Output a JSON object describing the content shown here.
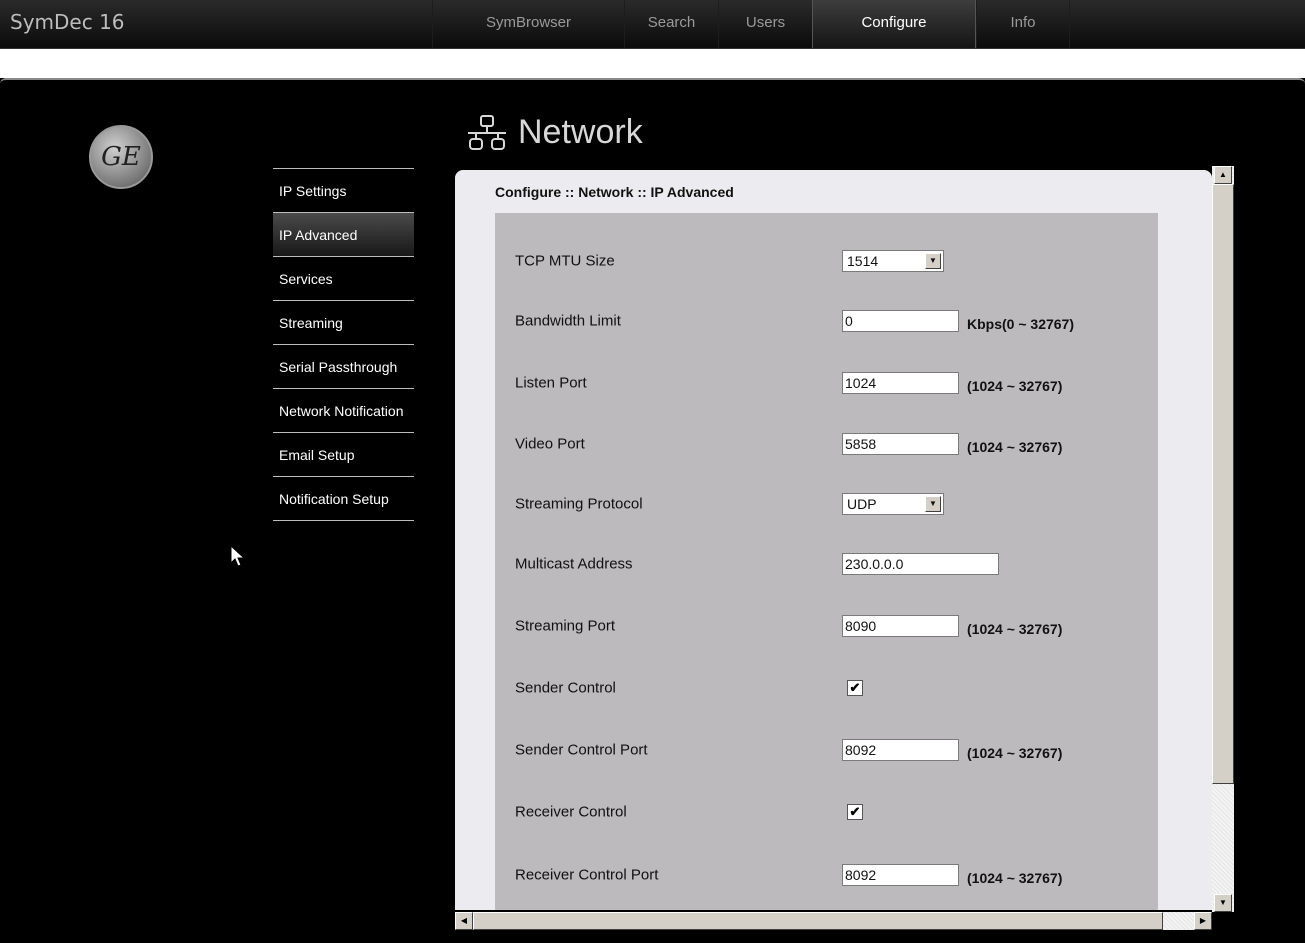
{
  "app": {
    "title": "SymDec 16"
  },
  "tabs": [
    {
      "label": "SymBrowser",
      "active": false
    },
    {
      "label": "Search",
      "active": false
    },
    {
      "label": "Users",
      "active": false
    },
    {
      "label": "Configure",
      "active": true
    },
    {
      "label": "Info",
      "active": false
    }
  ],
  "logo": {
    "text": "GE",
    "icon": "ge-logo"
  },
  "page": {
    "title": "Network",
    "icon": "network-icon"
  },
  "sidebar": {
    "items": [
      {
        "label": "IP Settings",
        "active": false
      },
      {
        "label": "IP Advanced",
        "active": true
      },
      {
        "label": "Services",
        "active": false
      },
      {
        "label": "Streaming",
        "active": false
      },
      {
        "label": "Serial Passthrough",
        "active": false
      },
      {
        "label": "Network Notification",
        "active": false
      },
      {
        "label": "Email Setup",
        "active": false
      },
      {
        "label": "Notification Setup",
        "active": false
      }
    ]
  },
  "content": {
    "breadcrumb": "Configure :: Network :: IP Advanced",
    "rows": {
      "tcp_mtu": {
        "label": "TCP MTU Size",
        "value": "1514"
      },
      "bandwidth": {
        "label": "Bandwidth Limit",
        "value": "0",
        "range": "Kbps(0 ~ 32767)"
      },
      "listen_port": {
        "label": "Listen Port",
        "value": "1024",
        "range": "(1024 ~ 32767)"
      },
      "video_port": {
        "label": "Video Port",
        "value": "5858",
        "range": "(1024 ~ 32767)"
      },
      "streaming_protocol": {
        "label": "Streaming Protocol",
        "value": "UDP"
      },
      "multicast": {
        "label": "Multicast Address",
        "value": "230.0.0.0"
      },
      "streaming_port": {
        "label": "Streaming Port",
        "value": "8090",
        "range": "(1024 ~ 32767)"
      },
      "sender_control": {
        "label": "Sender Control",
        "checked": true,
        "mark": "✔"
      },
      "sender_control_port": {
        "label": "Sender Control Port",
        "value": "8092",
        "range": "(1024 ~ 32767)"
      },
      "receiver_control": {
        "label": "Receiver Control",
        "checked": true,
        "mark": "✔"
      },
      "receiver_control_port": {
        "label": "Receiver Control Port",
        "value": "8092",
        "range": "(1024 ~ 32767)"
      }
    }
  },
  "scroll": {
    "up": "▲",
    "down": "▼",
    "left": "◀",
    "right": "▶",
    "dropdown": "▼"
  }
}
